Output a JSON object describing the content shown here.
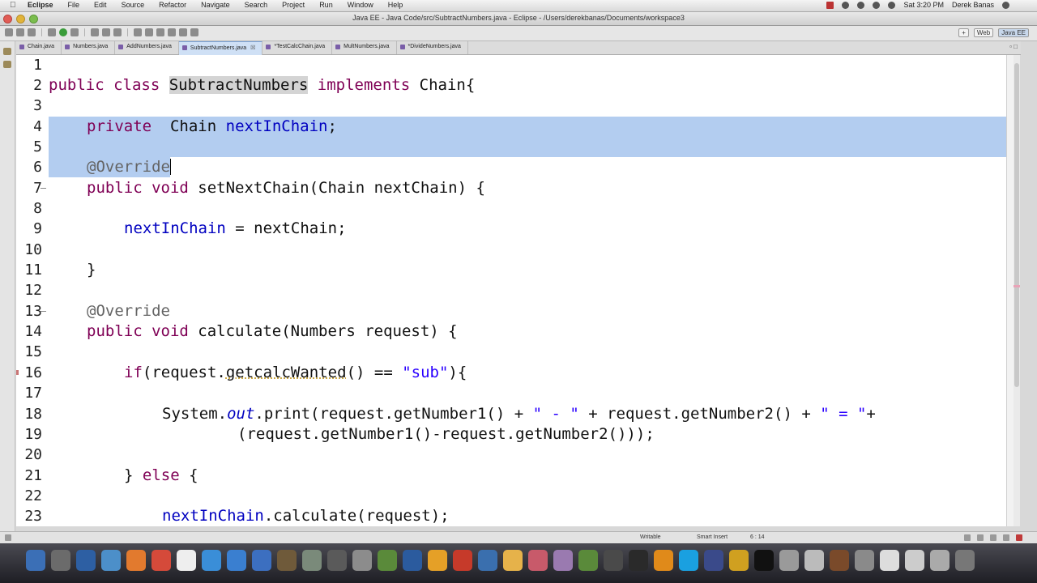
{
  "menubar": {
    "apple_icon": "apple-icon",
    "items": [
      "Eclipse",
      "File",
      "Edit",
      "Source",
      "Refactor",
      "Navigate",
      "Search",
      "Project",
      "Run",
      "Window",
      "Help"
    ],
    "clock": "Sat 3:20 PM",
    "user": "Derek Banas"
  },
  "window": {
    "title": "Java EE - Java Code/src/SubtractNumbers.java - Eclipse - /Users/derekbanas/Documents/workspace3"
  },
  "perspectives": {
    "web": "Web",
    "java_ee": "Java EE"
  },
  "tabs": [
    {
      "label": "Chain.java",
      "active": false
    },
    {
      "label": "Numbers.java",
      "active": false
    },
    {
      "label": "AddNumbers.java",
      "active": false
    },
    {
      "label": "SubtractNumbers.java",
      "active": true,
      "close": "☒"
    },
    {
      "label": "*TestCalcChain.java",
      "active": false
    },
    {
      "label": "MultNumbers.java",
      "active": false
    },
    {
      "label": "*DivideNumbers.java",
      "active": false
    }
  ],
  "editor": {
    "line_numbers": [
      "1",
      "2",
      "3",
      "4",
      "5",
      "6",
      "7",
      "8",
      "9",
      "10",
      "11",
      "12",
      "13",
      "14",
      "15",
      "16",
      "17",
      "18",
      "19",
      "20",
      "21",
      "22",
      "23"
    ],
    "l2": {
      "kw": "public class",
      "cls": "SubtractNumbers",
      "kw2": "implements",
      "rest": "Chain{"
    },
    "l4": {
      "kw": "private",
      "type": "Chain",
      "field": "nextInChain",
      "semi": ";"
    },
    "l6": {
      "anno": "@Override"
    },
    "l7": {
      "kw": "public void",
      "rest": "setNextChain(Chain nextChain) {"
    },
    "l9": {
      "field": "nextInChain",
      "rest": "= nextChain;"
    },
    "l11": {
      "text": "}"
    },
    "l13": {
      "anno": "@Override"
    },
    "l14": {
      "kw": "public void",
      "rest": "calculate(Numbers request) {"
    },
    "l16": {
      "kw": "if",
      "a": "(request.",
      "method": "getcalcWanted",
      "b": "() == ",
      "str": "\"sub\"",
      "c": "){"
    },
    "l18": {
      "a": "System.",
      "out": "out",
      "b": ".print(request.getNumber1() + ",
      "s1": "\" - \"",
      "c": " + request.getNumber2() + ",
      "s2": "\" = \"",
      "d": "+"
    },
    "l19": {
      "text": "(request.getNumber1()-request.getNumber2()));"
    },
    "l21": {
      "a": "} ",
      "kw": "else",
      "b": " {"
    },
    "l23": {
      "field": "nextInChain",
      "rest": ".calculate(request);"
    }
  },
  "status": {
    "writable": "Writable",
    "insert": "Smart Insert",
    "position": "6 : 14"
  }
}
